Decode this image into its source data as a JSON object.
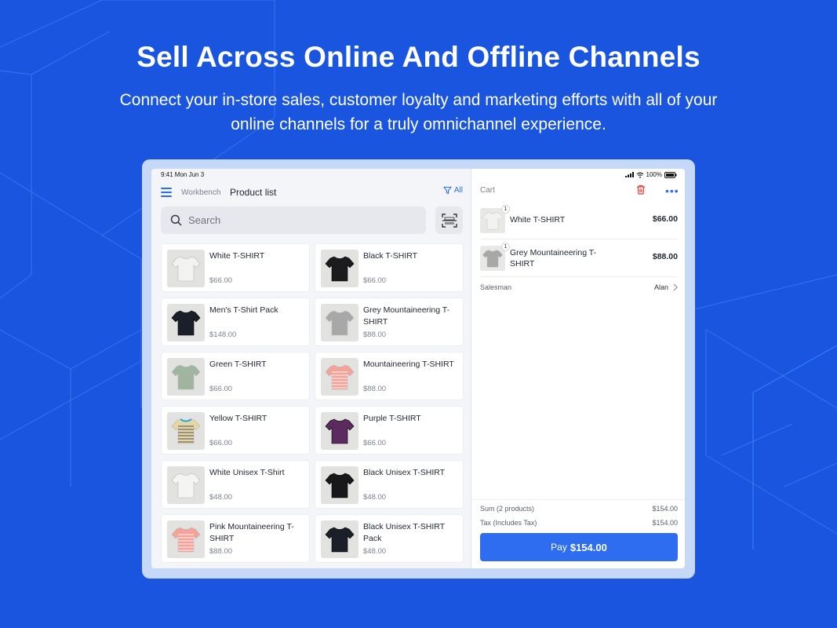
{
  "hero": {
    "title": "Sell Across Online And Offline Channels",
    "subtitle_line1": "Connect your in-store sales, customer loyalty and marketing efforts with all of your",
    "subtitle_line2": "online channels for a truly omnichannel experience."
  },
  "status_bar": {
    "time": "9:41  Mon Jun 3",
    "battery": "100%"
  },
  "header": {
    "breadcrumb": "Workbench",
    "title": "Product list",
    "filter_label": "All"
  },
  "search": {
    "placeholder": "Search"
  },
  "colors": {
    "accent": "#2e6cf0",
    "background": "#1a55e0",
    "danger": "#e53935"
  },
  "products": [
    {
      "name": "White T-SHIRT",
      "price": "$66.00",
      "shirt_color": "#f2f2f0",
      "stripes": false
    },
    {
      "name": "Black T-SHIRT",
      "price": "$66.00",
      "shirt_color": "#1c1c1e",
      "stripes": false
    },
    {
      "name": "Men's T-Shirt Pack",
      "price": "$148.00",
      "shirt_color": "#1b1f2a",
      "stripes": false
    },
    {
      "name": "Grey Mountaineering T-SHIRT",
      "price": "$88.00",
      "shirt_color": "#a8a8a8",
      "stripes": false
    },
    {
      "name": "Green T-SHIRT",
      "price": "$66.00",
      "shirt_color": "#9fb5a0",
      "stripes": false
    },
    {
      "name": "Mountaineering  T-SHIRT",
      "price": "$88.00",
      "shirt_color": "#f3a39a",
      "stripes": true
    },
    {
      "name": "Yellow T-SHIRT",
      "price": "$66.00",
      "shirt_color": "#e6d6a6",
      "stripes": true
    },
    {
      "name": "Purple T-SHIRT",
      "price": "$66.00",
      "shirt_color": "#5b2a5e",
      "stripes": false
    },
    {
      "name": "White Unisex T-Shirt",
      "price": "$48.00",
      "shirt_color": "#f4f4f2",
      "stripes": false
    },
    {
      "name": "Black Unisex T-SHIRT",
      "price": "$48.00",
      "shirt_color": "#18181b",
      "stripes": false
    },
    {
      "name": "Pink Mountaineering T-SHIRT",
      "price": "$88.00",
      "shirt_color": "#f3a39a",
      "stripes": true
    },
    {
      "name": "Black Unisex T-SHIRT Pack",
      "price": "$48.00",
      "shirt_color": "#1b1f2a",
      "stripes": false
    }
  ],
  "cart": {
    "title": "Cart",
    "items": [
      {
        "qty": "1",
        "name": "White T-SHIRT",
        "price": "$66.00",
        "shirt_color": "#f2f2f0"
      },
      {
        "qty": "1",
        "name": "Grey Mountaineering T-SHIRT",
        "price": "$88.00",
        "shirt_color": "#a8a8a8"
      }
    ],
    "salesman_label": "Salesman",
    "salesman_value": "Alan",
    "sum_label": "Sum (2 products)",
    "sum_value": "$154.00",
    "tax_label": "Tax (Includes Tax)",
    "tax_value": "$154.00",
    "pay_label": "Pay",
    "pay_amount": "$154.00"
  }
}
